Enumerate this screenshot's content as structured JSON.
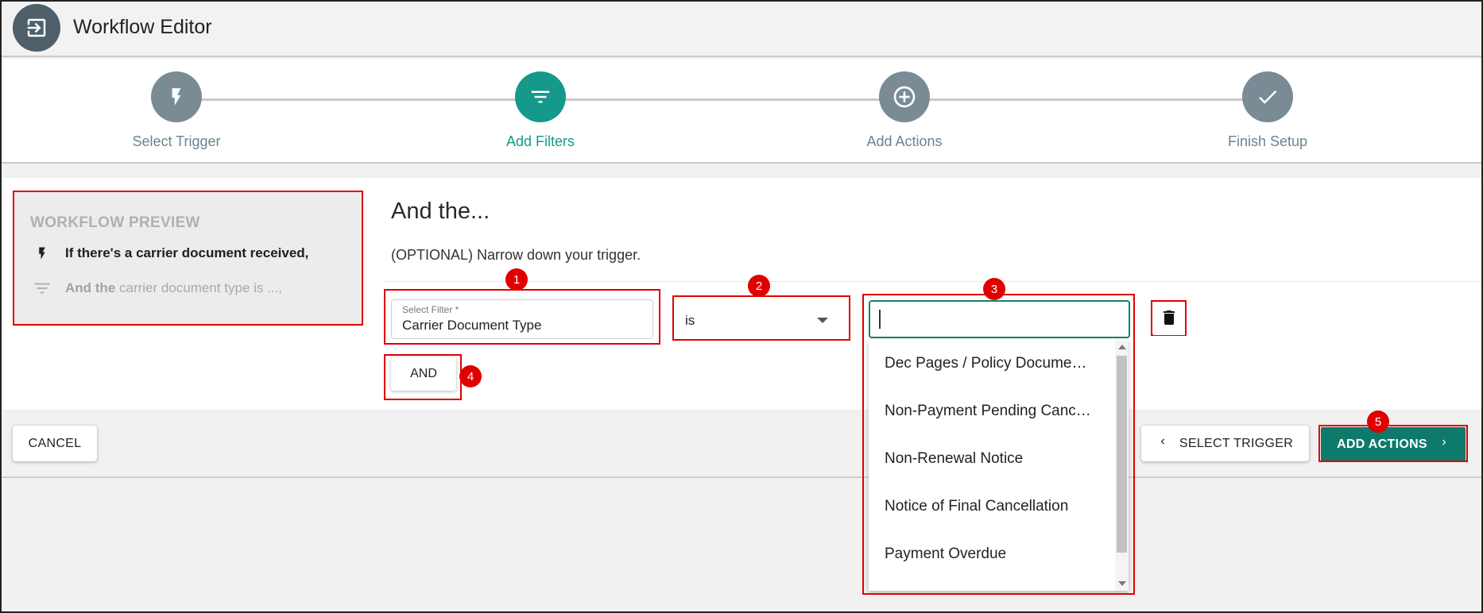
{
  "app": {
    "title": "Workflow Editor",
    "icon": "exit-to-app-icon"
  },
  "stepper": {
    "steps": [
      {
        "label": "Select Trigger",
        "icon": "bolt-icon",
        "active": false
      },
      {
        "label": "Add Filters",
        "icon": "filter-icon",
        "active": true
      },
      {
        "label": "Add Actions",
        "icon": "plus-circle-icon",
        "active": false
      },
      {
        "label": "Finish Setup",
        "icon": "check-icon",
        "active": false
      }
    ]
  },
  "preview": {
    "title": "WORKFLOW PREVIEW",
    "trigger_text": "If there's a carrier document received,",
    "filter_prefix": "And the",
    "filter_text": " carrier document type is ...,"
  },
  "main": {
    "heading": "And the...",
    "subtext": "(OPTIONAL) Narrow down your trigger."
  },
  "filter": {
    "label": "Select Filter *",
    "value": "Carrier Document Type",
    "operator": "is",
    "search_value": "",
    "options": [
      "Dec Pages / Policy Docume…",
      "Non-Payment Pending Canc…",
      "Non-Renewal Notice",
      "Notice of Final Cancellation",
      "Payment Overdue"
    ]
  },
  "buttons": {
    "and": "AND",
    "cancel": "CANCEL",
    "select_trigger": "SELECT TRIGGER",
    "add_actions": "ADD ACTIONS"
  },
  "annotations": [
    "1",
    "2",
    "3",
    "4",
    "5"
  ],
  "colors": {
    "accent": "#14998a",
    "primary_button": "#0e7a6b",
    "inactive_step": "#7a8b95",
    "highlight": "#e00000"
  }
}
